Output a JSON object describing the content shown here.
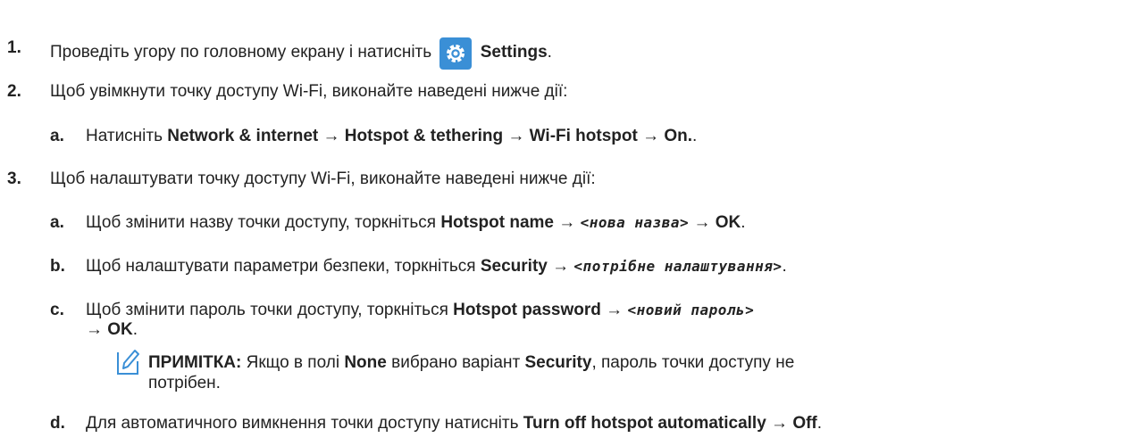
{
  "steps": {
    "s1": {
      "num": "1.",
      "text_a": "Проведіть угору по головному екрану і натисніть",
      "icon": "settings-gear-icon",
      "bold": "Settings",
      "end": "."
    },
    "s2": {
      "num": "2.",
      "text": "Щоб увімкнути точку доступу Wi-Fi, виконайте наведені нижче дії:"
    },
    "s2a": {
      "num": "a.",
      "text_a": "Натисніть",
      "bold": "Network & internet → Hotspot & tethering → Wi-Fi hotspot → On.",
      "end": "."
    },
    "s3": {
      "num": "3.",
      "text": "Щоб налаштувати точку доступу Wi-Fi, виконайте наведені нижче дії:"
    },
    "s3a": {
      "num": "a.",
      "text_a": "Щоб змінити назву точки доступу, торкніться",
      "bold_a": "Hotspot name →",
      "mono": "<нова назва>",
      "bold_b": "→ OK",
      "end": "."
    },
    "s3b": {
      "num": "b.",
      "text_a": "Щоб налаштувати параметри безпеки, торкніться",
      "bold_a": "Security →",
      "mono": "<потрібне налаштування>",
      "end": "."
    },
    "s3c": {
      "num": "c.",
      "text_a": "Щоб змінити пароль точки доступу, торкніться",
      "bold_a": "Hotspot password →",
      "mono": "<новий пароль>",
      "bold_b": "→ OK",
      "end": "."
    },
    "note": {
      "icon": "pencil-note-icon",
      "label": "ПРИМІТКА:",
      "text_a": "Якщо в полі",
      "bold_a": "None",
      "text_b": "вибрано варіант",
      "bold_b": "Security",
      "text_c": ", пароль точки доступу не",
      "text_d": "потрібен."
    },
    "s3d": {
      "num": "d.",
      "text_a": "Для автоматичного вимкнення точки доступу натисніть",
      "bold_a": "Turn off hotspot automatically → Off",
      "end": "."
    }
  }
}
